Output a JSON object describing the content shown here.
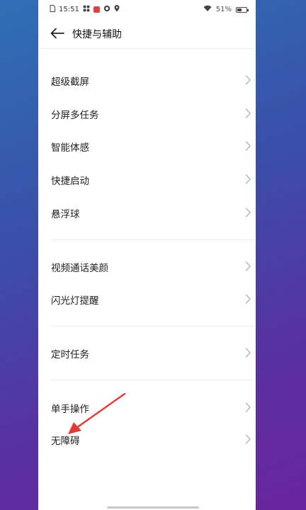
{
  "status_bar": {
    "time": "15:51",
    "battery": "51%",
    "battery_level": 0.51
  },
  "header": {
    "title": "快捷与辅助"
  },
  "groups": [
    {
      "items": [
        "超级截屏",
        "分屏多任务",
        "智能体感",
        "快捷启动",
        "悬浮球"
      ]
    },
    {
      "items": [
        "视频通话美颜",
        "闪光灯提醒"
      ]
    },
    {
      "items": [
        "定时任务"
      ]
    },
    {
      "items": [
        "单手操作",
        "无障碍"
      ]
    }
  ],
  "annotation": {
    "color": "#e53935",
    "target": "无障碍"
  },
  "colors": {
    "background_start": "#2f6fb6",
    "background_end": "#6a259c",
    "panel": "#ffffff",
    "text": "#222222",
    "chevron": "#b5b5b5"
  }
}
